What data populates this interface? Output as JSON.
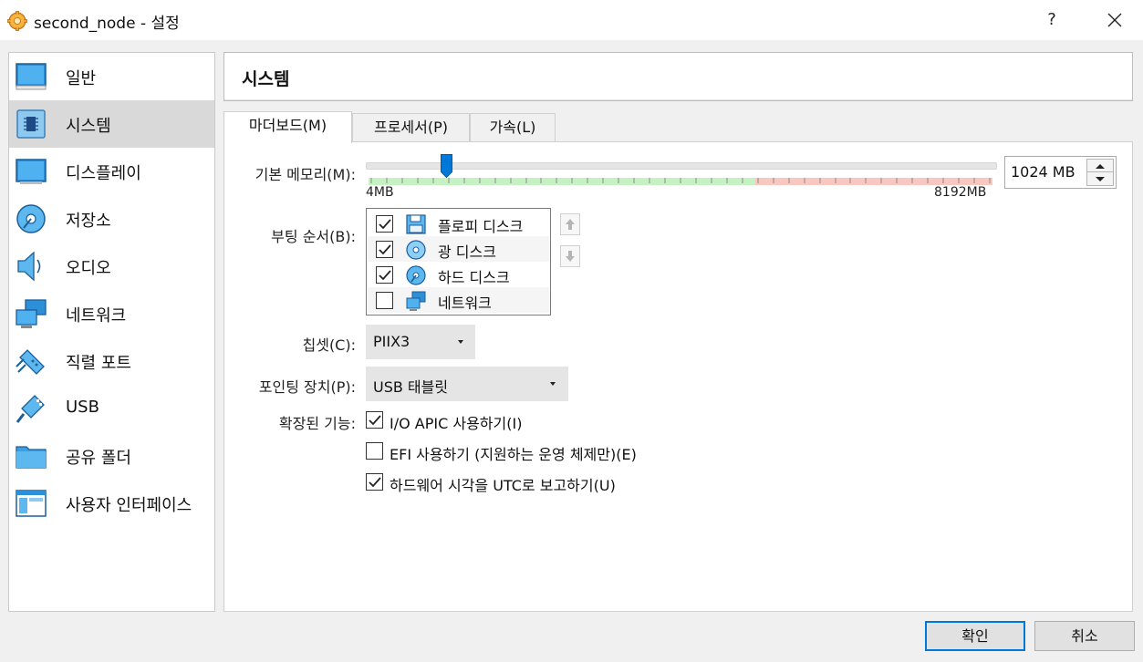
{
  "window": {
    "title": "second_node - 설정",
    "help_label": "?"
  },
  "sidebar": {
    "items": [
      {
        "label": "일반",
        "icon": "general-icon"
      },
      {
        "label": "시스템",
        "icon": "system-icon",
        "selected": true
      },
      {
        "label": "디스플레이",
        "icon": "display-icon"
      },
      {
        "label": "저장소",
        "icon": "storage-icon"
      },
      {
        "label": "오디오",
        "icon": "audio-icon"
      },
      {
        "label": "네트워크",
        "icon": "network-icon"
      },
      {
        "label": "직렬 포트",
        "icon": "serial-port-icon"
      },
      {
        "label": "USB",
        "icon": "usb-icon"
      },
      {
        "label": "공유 폴더",
        "icon": "shared-folder-icon"
      },
      {
        "label": "사용자 인터페이스",
        "icon": "user-interface-icon"
      }
    ]
  },
  "header": {
    "title": "시스템"
  },
  "tabs": [
    {
      "label": "마더보드(M)",
      "active": true
    },
    {
      "label": "프로세서(P)",
      "active": false
    },
    {
      "label": "가속(L)",
      "active": false
    }
  ],
  "motherboard": {
    "memory": {
      "label": "기본 메모리(M):",
      "value": 1024,
      "min": 4,
      "max": 8192,
      "min_label": "4MB",
      "max_label": "8192MB",
      "display_value": "1024 MB",
      "recommended_fraction": 0.62
    },
    "boot_order": {
      "label": "부팅 순서(B):",
      "items": [
        {
          "label": "플로피 디스크",
          "checked": true,
          "icon": "floppy-icon"
        },
        {
          "label": "광 디스크",
          "checked": true,
          "icon": "optical-disc-icon"
        },
        {
          "label": "하드 디스크",
          "checked": true,
          "icon": "hard-disk-icon"
        },
        {
          "label": "네트워크",
          "checked": false,
          "icon": "network-icon"
        }
      ]
    },
    "chipset": {
      "label": "칩셋(C):",
      "value": "PIIX3"
    },
    "pointing_device": {
      "label": "포인팅 장치(P):",
      "value": "USB 태블릿"
    },
    "extended": {
      "label": "확장된 기능:",
      "options": [
        {
          "label": "I/O APIC 사용하기(I)",
          "checked": true
        },
        {
          "label": "EFI 사용하기 (지원하는 운영 체제만)(E)",
          "checked": false
        },
        {
          "label": "하드웨어 시각을 UTC로 보고하기(U)",
          "checked": true
        }
      ]
    }
  },
  "buttons": {
    "ok": "확인",
    "cancel": "취소"
  },
  "colors": {
    "accent": "#0078d7",
    "slider_safe": "#c6f2c3",
    "slider_warn": "#f8c7c0",
    "selected_bg": "#d9d9d9"
  }
}
